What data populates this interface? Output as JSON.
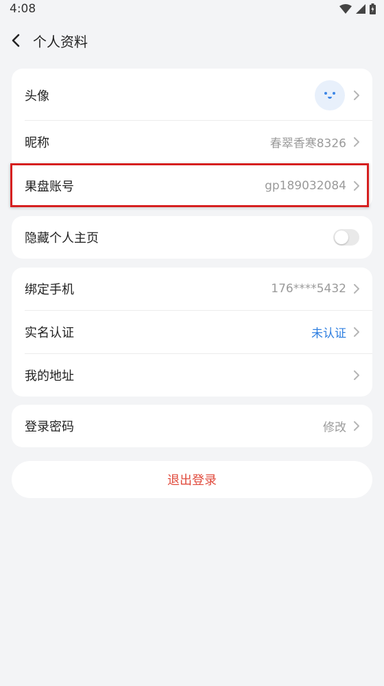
{
  "status_bar": {
    "time": "4:08"
  },
  "header": {
    "title": "个人资料"
  },
  "profile": {
    "avatar_label": "头像",
    "nickname_label": "昵称",
    "nickname_value": "春翠香寒8326",
    "account_label": "果盘账号",
    "account_value": "gp189032084"
  },
  "privacy": {
    "hide_homepage_label": "隐藏个人主页",
    "hide_homepage_enabled": false
  },
  "binding": {
    "phone_label": "绑定手机",
    "phone_value": "176****5432",
    "realname_label": "实名认证",
    "realname_value": "未认证",
    "address_label": "我的地址"
  },
  "security": {
    "password_label": "登录密码",
    "password_value": "修改"
  },
  "logout_label": "退出登录",
  "colors": {
    "background": "#f3f4f6",
    "link": "#2f7fe0",
    "logout": "#e04a3c",
    "highlight": "#d61f1f"
  }
}
